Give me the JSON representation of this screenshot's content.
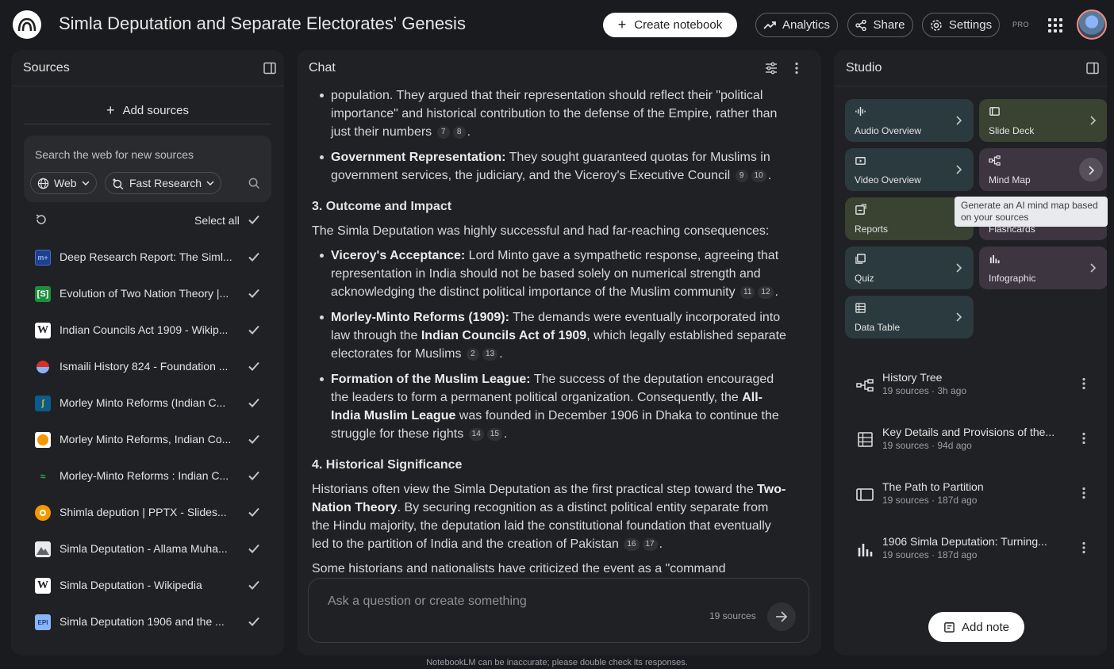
{
  "header": {
    "title": "Simla Deputation and Separate Electorates' Genesis",
    "create_label": "Create notebook",
    "analytics_label": "Analytics",
    "share_label": "Share",
    "settings_label": "Settings",
    "pro_badge": "PRO"
  },
  "sources": {
    "title": "Sources",
    "add_label": "Add sources",
    "search_placeholder": "Search the web for new sources",
    "web_chip": "Web",
    "research_chip": "Fast Research",
    "select_all": "Select all",
    "items": [
      {
        "label": "Deep Research Report: The Siml...",
        "icon": "deep-research-icon"
      },
      {
        "label": "Evolution of Two Nation Theory |...",
        "icon": "scribd-icon"
      },
      {
        "label": "Indian Councils Act 1909 - Wikip...",
        "icon": "wikipedia-icon"
      },
      {
        "label": "Ismaili History 824 - Foundation ...",
        "icon": "site-icon"
      },
      {
        "label": "Morley Minto Reforms (Indian C...",
        "icon": "site-icon"
      },
      {
        "label": "Morley Minto Reforms, Indian Co...",
        "icon": "site-icon"
      },
      {
        "label": "Morley-Minto Reforms : Indian C...",
        "icon": "site-icon"
      },
      {
        "label": "Shimla depution | PPTX - Slides...",
        "icon": "slideshare-icon"
      },
      {
        "label": "Simla Deputation - Allama Muha...",
        "icon": "site-icon"
      },
      {
        "label": "Simla Deputation - Wikipedia",
        "icon": "wikipedia-icon"
      },
      {
        "label": "Simla Deputation 1906 and the ...",
        "icon": "pdf-icon"
      }
    ]
  },
  "chat": {
    "title": "Chat",
    "p1": "population. They argued that their representation should reflect their \"political importance\" and historical contribution to the defense of the Empire, rather than just their numbers",
    "b1_bold": "Government Representation:",
    "b1_text": " They sought guaranteed quotas for Muslims in government services, the judiciary, and the Viceroy's Executive Council",
    "h3": "3. Outcome and Impact",
    "p2": "The Simla Deputation was highly successful and had far-reaching consequences:",
    "b2_bold": "Viceroy's Acceptance:",
    "b2_text": " Lord Minto gave a sympathetic response, agreeing that representation in India should not be based solely on numerical strength and acknowledging the distinct political importance of the Muslim community",
    "b3_bold": "Morley-Minto Reforms (1909):",
    "b3_text1": " The demands were eventually incorporated into law through the ",
    "b3_bold2": "Indian Councils Act of 1909",
    "b3_text2": ", which legally established separate electorates for Muslims",
    "b4_bold": "Formation of the Muslim League:",
    "b4_text1": " The success of the deputation encouraged the leaders to form a permanent political organization. Consequently, the ",
    "b4_bold2": "All-India Muslim League",
    "b4_text2": " was founded in December 1906 in Dhaka to continue the struggle for these rights",
    "h4": "4. Historical Significance",
    "p3_text1": "Historians often view the Simla Deputation as the first practical step toward the ",
    "p3_bold": "Two-Nation Theory",
    "p3_text2": ". By securing recognition as a distinct political entity separate from the Hindu majority, the deputation laid the constitutional foundation that eventually led to the partition of India and the creation of Pakistan",
    "p4": "Some historians and nationalists have criticized the event as a \"command",
    "cites": {
      "c7": "7",
      "c8": "8",
      "c9": "9",
      "c10": "10",
      "c11": "11",
      "c12": "12",
      "c2": "2",
      "c13": "13",
      "c14": "14",
      "c15": "15",
      "c16": "16",
      "c17": "17"
    },
    "input_placeholder": "Ask a question or create something",
    "source_count": "19 sources"
  },
  "studio": {
    "title": "Studio",
    "tiles": [
      {
        "label": "Audio Overview",
        "color": "#2b3a3f"
      },
      {
        "label": "Slide Deck",
        "color": "#3a4232"
      },
      {
        "label": "Video Overview",
        "color": "#2b3a3f"
      },
      {
        "label": "Mind Map",
        "color": "#3d3540"
      },
      {
        "label": "Reports",
        "color": "#3a4232"
      },
      {
        "label": "Flashcards",
        "color": "#3d3540"
      },
      {
        "label": "Quiz",
        "color": "#2b3a3f"
      },
      {
        "label": "Infographic",
        "color": "#3d3540"
      },
      {
        "label": "Data Table",
        "color": "#2b3a3f"
      }
    ],
    "tooltip": "Generate an AI mind map based on your sources",
    "notes": [
      {
        "title": "History Tree",
        "meta": "19 sources · 3h ago",
        "icon": "mind-map-icon"
      },
      {
        "title": "Key Details and Provisions of the...",
        "meta": "19 sources · 94d ago",
        "icon": "data-table-icon"
      },
      {
        "title": "The Path to Partition",
        "meta": "19 sources · 187d ago",
        "icon": "slide-deck-icon"
      },
      {
        "title": "1906 Simla Deputation: Turning...",
        "meta": "19 sources · 187d ago",
        "icon": "infographic-icon"
      }
    ],
    "add_note_label": "Add note"
  },
  "footer": "NotebookLM can be inaccurate; please double check its responses."
}
